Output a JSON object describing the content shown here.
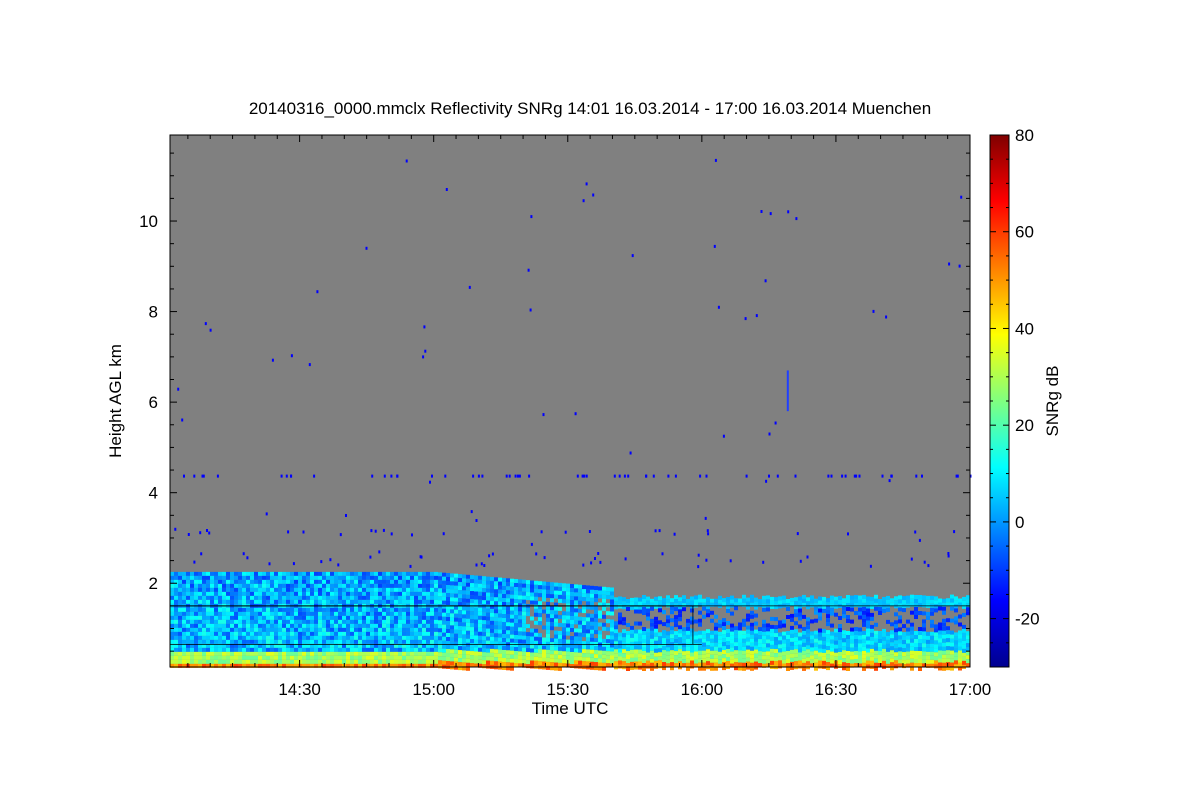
{
  "chart_data": {
    "type": "heatmap",
    "title": "20140316_0000.mmclx Reflectivity SNRg   14:01 16.03.2014 - 17:00 16.03.2014 Muenchen",
    "xlabel": "Time UTC",
    "ylabel": "Height AGL km",
    "colorbar_label": "SNRg dB",
    "x_range": [
      "14:01",
      "17:00"
    ],
    "x_range_minutes": [
      841,
      1020
    ],
    "y_range_km": [
      0.15,
      11.9
    ],
    "x_ticks": [
      {
        "label": "14:30",
        "minutes": 870
      },
      {
        "label": "15:00",
        "minutes": 900
      },
      {
        "label": "15:30",
        "minutes": 930
      },
      {
        "label": "16:00",
        "minutes": 960
      },
      {
        "label": "16:30",
        "minutes": 990
      },
      {
        "label": "17:00",
        "minutes": 1020
      }
    ],
    "y_ticks": [
      {
        "label": "2",
        "value": 2
      },
      {
        "label": "4",
        "value": 4
      },
      {
        "label": "6",
        "value": 6
      },
      {
        "label": "8",
        "value": 8
      },
      {
        "label": "10",
        "value": 10
      }
    ],
    "colorbar_range": [
      -30,
      80
    ],
    "colorbar_ticks": [
      {
        "label": "-20",
        "value": -20
      },
      {
        "label": "0",
        "value": 0
      },
      {
        "label": "20",
        "value": 20
      },
      {
        "label": "40",
        "value": 40
      },
      {
        "label": "60",
        "value": 60
      },
      {
        "label": "80",
        "value": 80
      }
    ],
    "background_color": "#808080",
    "colormap": [
      "#00008f",
      "#0000ff",
      "#0080ff",
      "#00ffff",
      "#80ff80",
      "#ffff00",
      "#ff8000",
      "#ff0000",
      "#800000"
    ],
    "echo_layers": [
      {
        "t_start": 841,
        "t_end": 900,
        "h_bottom": 0.15,
        "h_top": 2.25,
        "snr_approx": 5
      },
      {
        "t_start": 900,
        "t_end": 940,
        "h_bottom": 0.15,
        "h_top": 2.05,
        "snr_approx": 3
      },
      {
        "t_start": 940,
        "t_end": 1020,
        "h_bottom": 0.15,
        "h_top": 1.75,
        "snr_approx": 0
      },
      {
        "t_start": 841,
        "t_end": 1020,
        "h_bottom": 0.15,
        "h_top": 0.5,
        "snr_approx": 30
      }
    ]
  }
}
